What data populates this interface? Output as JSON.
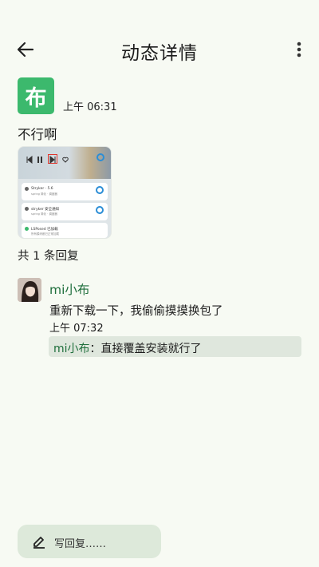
{
  "header": {
    "title": "动态详情"
  },
  "post": {
    "logo_text": "布",
    "time": "上午 06:31",
    "text": "不行啊",
    "image": {
      "notifications": [
        {
          "title": "Stryker · 5.6",
          "subtitle": "spring 简化 · 调度器"
        },
        {
          "title": "stryker 安全通知",
          "subtitle": "spring 简化 · 调度器"
        },
        {
          "title": "LSPosed 已加载",
          "subtitle": "所有模块都已正常加载"
        }
      ]
    },
    "reply_count": "共 1 条回复"
  },
  "comments": [
    {
      "user": "mi小布",
      "text": "重新下载一下，我偷偷摸摸换包了",
      "time": "上午 07:32",
      "reply": {
        "user": "mi小布",
        "separator": "：",
        "text": "直接覆盖安装就行了"
      }
    }
  ],
  "footer": {
    "write_reply": "写回复……"
  },
  "colors": {
    "brand": "#3cb96d",
    "username": "#1f6f3c",
    "background": "#f7faf3"
  }
}
